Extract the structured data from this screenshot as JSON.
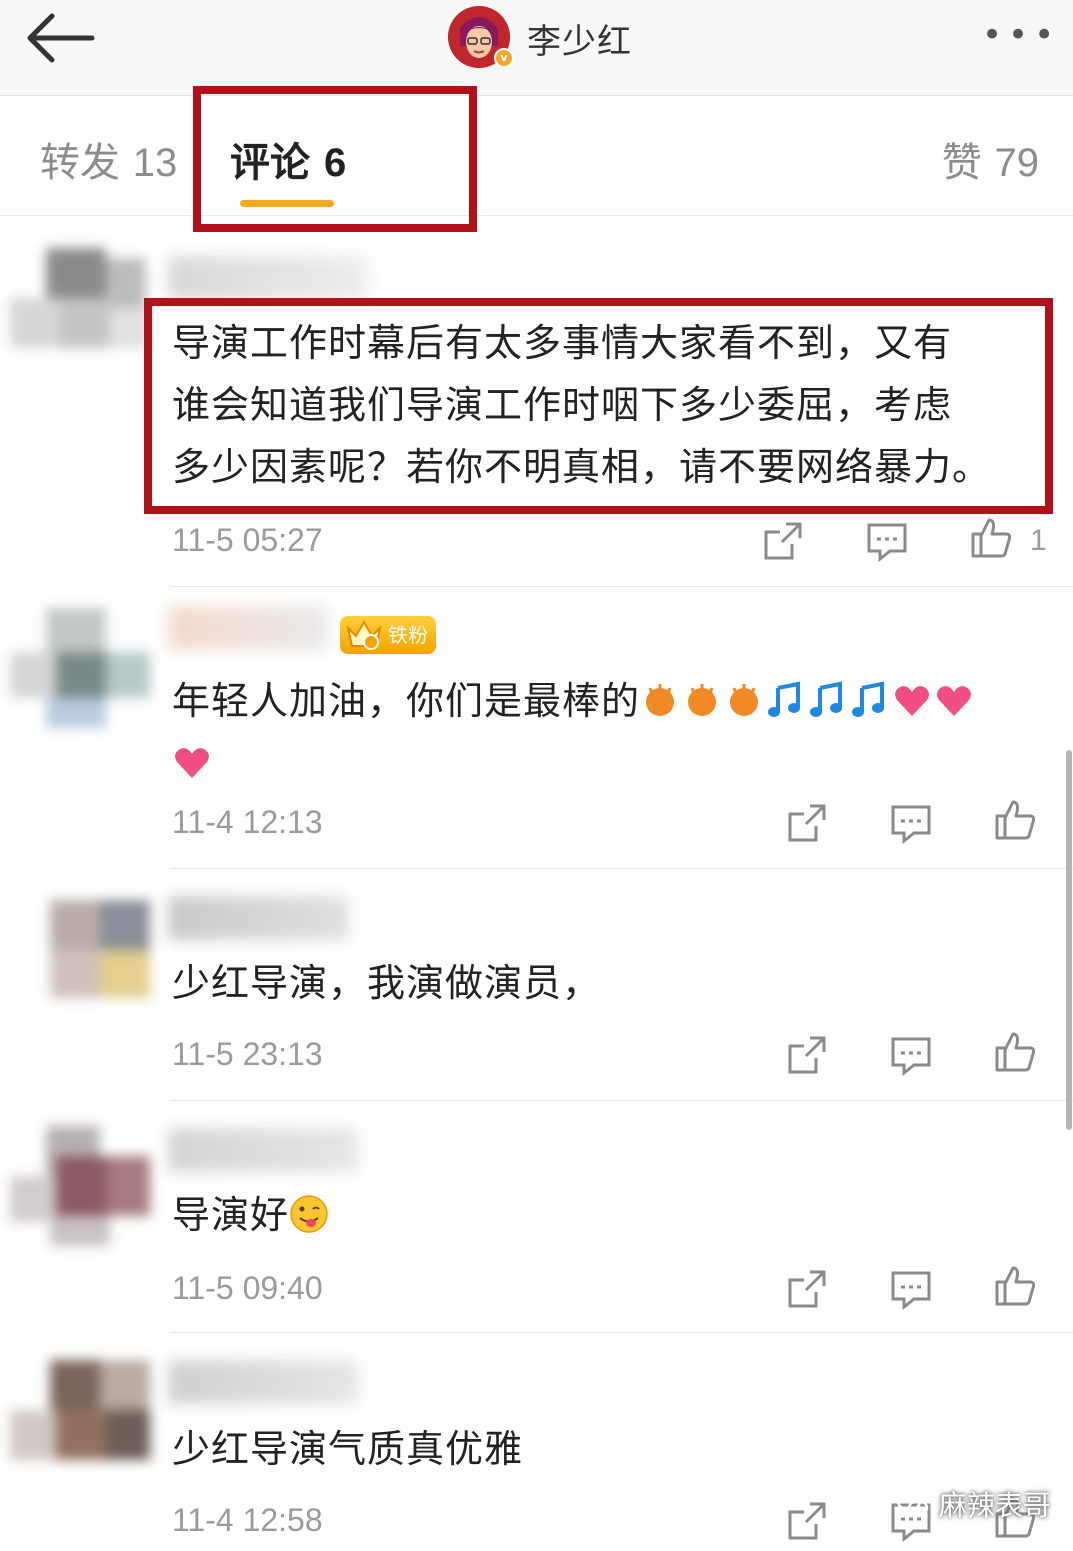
{
  "header": {
    "title": "李少红",
    "back_icon": "back-arrow-icon",
    "more_label": "•••",
    "verified_badge": "v"
  },
  "tabs": [
    {
      "label": "转发",
      "count": "13"
    },
    {
      "label": "评论",
      "count": "6",
      "active": true
    },
    {
      "label": "赞",
      "count": "79"
    }
  ],
  "colors": {
    "accent": "#f5a623",
    "highlight_box": "#b3111a",
    "text_primary": "#222222",
    "text_secondary": "#9a9a9a"
  },
  "comments": [
    {
      "text_lines": [
        "导演工作时幕后有太多事情大家看不到，又有",
        "谁会知道我们导演工作时咽下多少委屈，考虑",
        "多少因素呢？若你不明真相，请不要网络暴力。"
      ],
      "time": "11-5 05:27",
      "likes": "1"
    },
    {
      "badge": "铁粉",
      "text": "年轻人加油，你们是最棒的",
      "emojis": [
        "clap-emoji",
        "clap-emoji",
        "clap-emoji",
        "music-note-emoji",
        "music-note-emoji",
        "music-note-emoji",
        "heart-emoji",
        "heart-emoji",
        "heart-emoji"
      ],
      "time": "11-4 12:13",
      "likes": ""
    },
    {
      "text": "少红导演，我演做演员，",
      "time": "11-5 23:13",
      "likes": ""
    },
    {
      "text": "导演好",
      "emojis": [
        "wink-tongue-emoji"
      ],
      "time": "11-5 09:40",
      "likes": ""
    },
    {
      "text": "少红导演气质真优雅",
      "time": "11-4 12:58",
      "likes": ""
    }
  ],
  "actions": {
    "repost_icon": "repost-icon",
    "comment_icon": "comment-icon",
    "like_icon": "thumbs-up-icon"
  },
  "watermark": "麻辣表哥"
}
